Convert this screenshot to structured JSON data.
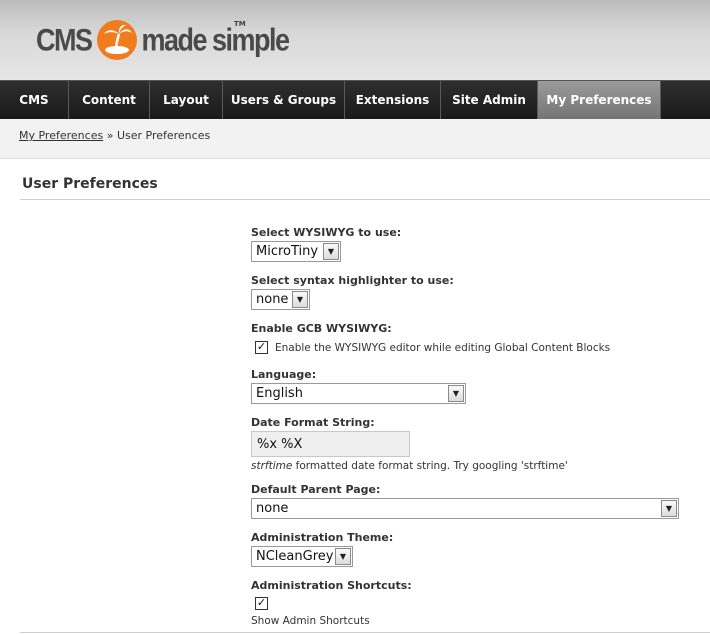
{
  "logo": {
    "part1": "cms",
    "part2": "made simple",
    "tm": "TM"
  },
  "nav": {
    "items": [
      {
        "label": "CMS"
      },
      {
        "label": "Content"
      },
      {
        "label": "Layout"
      },
      {
        "label": "Users & Groups"
      },
      {
        "label": "Extensions"
      },
      {
        "label": "Site Admin"
      },
      {
        "label": "My Preferences"
      }
    ],
    "active_index": 6
  },
  "breadcrumb": {
    "link": "My Preferences",
    "separator": " » ",
    "current": "User Preferences"
  },
  "page_title": "User Preferences",
  "form": {
    "wysiwyg": {
      "label": "Select WYSIWYG to use:",
      "value": "MicroTiny"
    },
    "syntax": {
      "label": "Select syntax highlighter to use:",
      "value": "none"
    },
    "gcb": {
      "label": "Enable GCB WYSIWYG:",
      "checked": true,
      "checkbox_label": "Enable the WYSIWYG editor while editing Global Content Blocks"
    },
    "language": {
      "label": "Language:",
      "value": "English"
    },
    "date_format": {
      "label": "Date Format String:",
      "value": "%x %X",
      "help_em": "strftime",
      "help_rest": " formatted date format string. Try googling 'strftime'"
    },
    "parent_page": {
      "label": "Default Parent Page:",
      "value": "none"
    },
    "theme": {
      "label": "Administration Theme:",
      "value": "NCleanGrey"
    },
    "shortcuts": {
      "label": "Administration Shortcuts:",
      "checked": true,
      "checkbox_label": "Show Admin Shortcuts"
    }
  },
  "colors": {
    "nav_bg": "#1a1a1a",
    "nav_active": "#8a8a8a",
    "logo_orange": "#f07c1e"
  }
}
